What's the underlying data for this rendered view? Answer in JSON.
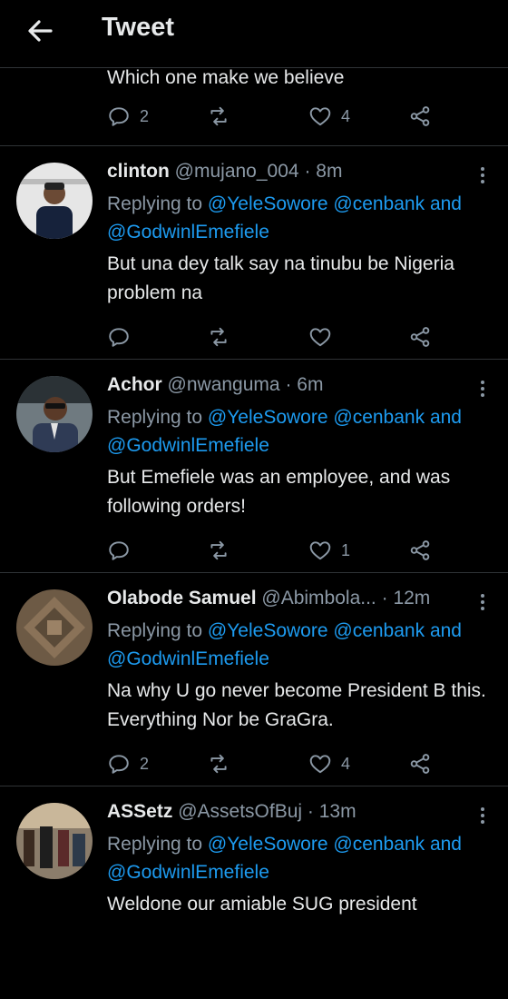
{
  "header": {
    "title": "Tweet",
    "back_icon": "arrow-left-icon"
  },
  "partial_tweet": {
    "text": "Which one make we believe",
    "replies": "2",
    "likes": "4"
  },
  "tweets": [
    {
      "name": "clinton",
      "handle": "@mujano_004",
      "sep": "·",
      "time": "8m",
      "replying_prefix": "Replying to",
      "mention1": "@YeleSowore",
      "mention2": "@cenbank",
      "and": "and",
      "mention3": "@GodwinlEmefiele",
      "text": "But una dey talk say na tinubu be Nigeria problem na",
      "replies": "",
      "likes": ""
    },
    {
      "name": "Achor",
      "handle": "@nwanguma",
      "sep": "·",
      "time": "6m",
      "replying_prefix": "Replying to",
      "mention1": "@YeleSowore",
      "mention2": "@cenbank",
      "and": "and",
      "mention3": "@GodwinlEmefiele",
      "text": "But Emefiele was an employee, and was following orders!",
      "replies": "",
      "likes": "1"
    },
    {
      "name": "Olabode Samuel",
      "handle": "@Abimbola...",
      "sep": "·",
      "time": "12m",
      "replying_prefix": "Replying to",
      "mention1": "@YeleSowore",
      "mention2": "@cenbank",
      "and": "and",
      "mention3": "@GodwinlEmefiele",
      "text": "Na why U go never become President B this. Everything Nor be GraGra.",
      "replies": "2",
      "likes": "4"
    },
    {
      "name": "ASSetz",
      "handle": "@AssetsOfBuj",
      "sep": "·",
      "time": "13m",
      "replying_prefix": "Replying to",
      "mention1": "@YeleSowore",
      "mention2": "@cenbank",
      "and": "and",
      "mention3": "@GodwinlEmefiele",
      "text": "Weldone our amiable SUG president",
      "replies": "",
      "likes": ""
    }
  ],
  "colors": {
    "background": "#000000",
    "text": "#e7e9ea",
    "secondary": "#8b98a5",
    "accent": "#1d9bf0",
    "divider": "#2f3336"
  }
}
